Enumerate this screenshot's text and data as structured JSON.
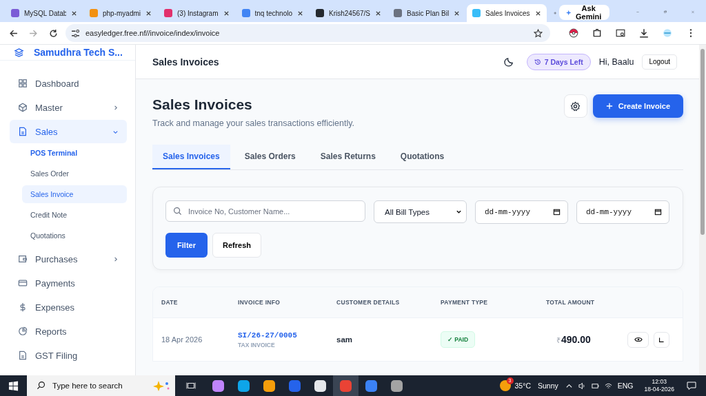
{
  "browser": {
    "tabs": [
      {
        "title": "MySQL Datab",
        "color": "#7b5cd6",
        "selected": false
      },
      {
        "title": "php-myadmi",
        "color": "#f29111",
        "selected": false
      },
      {
        "title": "(3) Instagram",
        "color": "#e1306c",
        "selected": false
      },
      {
        "title": "tnq technolo",
        "color": "#4285f4",
        "selected": false
      },
      {
        "title": "Krish24567/S",
        "color": "#24292f",
        "selected": false
      },
      {
        "title": "Basic Plan Bil",
        "color": "#6b7280",
        "selected": false
      },
      {
        "title": "Sales Invoices",
        "color": "#38bdf8",
        "selected": true
      }
    ],
    "ask": "Ask Gemini",
    "url": "easyledger.free.nf//invoice/index/invoice"
  },
  "sidebar": {
    "brand": "Samudhra Tech S...",
    "items": [
      {
        "label": "Dashboard",
        "kind": "grid",
        "submenu": false,
        "selected": false
      },
      {
        "label": "Master",
        "kind": "box",
        "submenu": true,
        "selected": false,
        "expanded": false
      },
      {
        "label": "Sales",
        "kind": "file",
        "submenu": true,
        "selected": true,
        "expanded": true,
        "children": [
          {
            "label": "POS Terminal",
            "bold": true,
            "selected": false
          },
          {
            "label": "Sales Order",
            "bold": false,
            "selected": false
          },
          {
            "label": "Sales Invoice",
            "bold": false,
            "selected": true
          },
          {
            "label": "Credit Note",
            "bold": false,
            "selected": false
          },
          {
            "label": "Quotations",
            "bold": false,
            "selected": false
          }
        ]
      },
      {
        "label": "Purchases",
        "kind": "wallet",
        "submenu": true,
        "selected": false,
        "expanded": false
      },
      {
        "label": "Payments",
        "kind": "card",
        "submenu": false,
        "selected": false
      },
      {
        "label": "Expenses",
        "kind": "dollar",
        "submenu": false,
        "selected": false
      },
      {
        "label": "Reports",
        "kind": "pie",
        "submenu": false,
        "selected": false
      },
      {
        "label": "GST Filing",
        "kind": "file",
        "submenu": false,
        "selected": false
      }
    ]
  },
  "header": {
    "title": "Sales Invoices",
    "trial": "7 Days Left",
    "greeting": "Hi, Baalu",
    "logout": "Logout"
  },
  "page": {
    "title": "Sales Invoices",
    "subtitle": "Track and manage your sales transactions efficiently.",
    "create": "Create Invoice"
  },
  "tabs": [
    {
      "label": "Sales Invoices",
      "selected": true
    },
    {
      "label": "Sales Orders",
      "selected": false
    },
    {
      "label": "Sales Returns",
      "selected": false
    },
    {
      "label": "Quotations",
      "selected": false
    }
  ],
  "filters": {
    "search": {
      "placeholder": "Invoice No, Customer Name..."
    },
    "bill_type": "All Bill Types",
    "date_from": {
      "placeholder": "dd-mm-yyyy"
    },
    "date_to": {
      "placeholder": "dd-mm-yyyy"
    },
    "filter": "Filter",
    "refresh": "Refresh"
  },
  "table": {
    "columns": [
      "DATE",
      "INVOICE INFO",
      "CUSTOMER DETAILS",
      "PAYMENT TYPE",
      "TOTAL AMOUNT"
    ],
    "rows": [
      {
        "date": "18 Apr 2026",
        "invoice_no": "SI/26-27/0005",
        "invoice_type": "TAX INVOICE",
        "customer": "sam",
        "status": "PAID",
        "status_mark": "✓",
        "currency": "₹",
        "amount": "490.00"
      }
    ]
  },
  "taskbar": {
    "search": {
      "placeholder": "Type here to search"
    },
    "apps": [
      {
        "color": "#c084fc",
        "selected": false
      },
      {
        "color": "#0ea5e9",
        "selected": false
      },
      {
        "color": "#f59e0b",
        "selected": false
      },
      {
        "color": "#2563eb",
        "selected": false
      },
      {
        "color": "#e5e7eb",
        "selected": false
      },
      {
        "color": "#ea4335",
        "selected": true
      },
      {
        "color": "#3b82f6",
        "selected": false
      },
      {
        "color": "#a3a3a3",
        "selected": false
      }
    ],
    "weather_badge": "3",
    "temperature": "35°C",
    "weather": "Sunny",
    "language": "ENG",
    "time": "12:03",
    "date": "18-04-2026"
  }
}
